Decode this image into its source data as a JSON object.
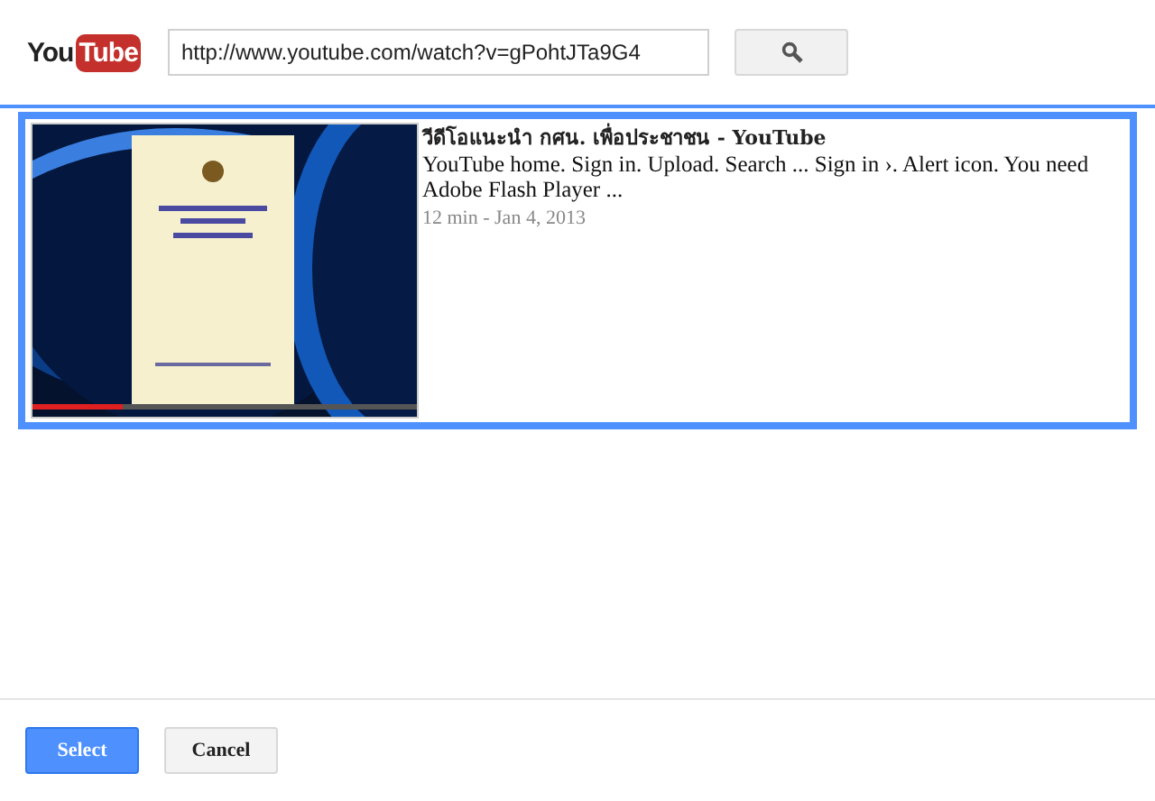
{
  "logo": {
    "part_1": "You",
    "part_2": "Tube"
  },
  "search": {
    "value": "http://www.youtube.com/watch?v=gPohtJTa9G4"
  },
  "results": [
    {
      "selected": true,
      "title": "วีดีโอแนะนำ กศน. เพื่อประชาชน - YouTube",
      "snippet": "YouTube home. Sign in. Upload. Search ... Sign in ›. Alert icon. You need Adobe Flash Player ...",
      "meta": "12 min - Jan 4, 2013"
    }
  ],
  "buttons": [
    {
      "label": "Select",
      "kind": "primary"
    },
    {
      "label": "Cancel",
      "kind": "secondary"
    }
  ]
}
